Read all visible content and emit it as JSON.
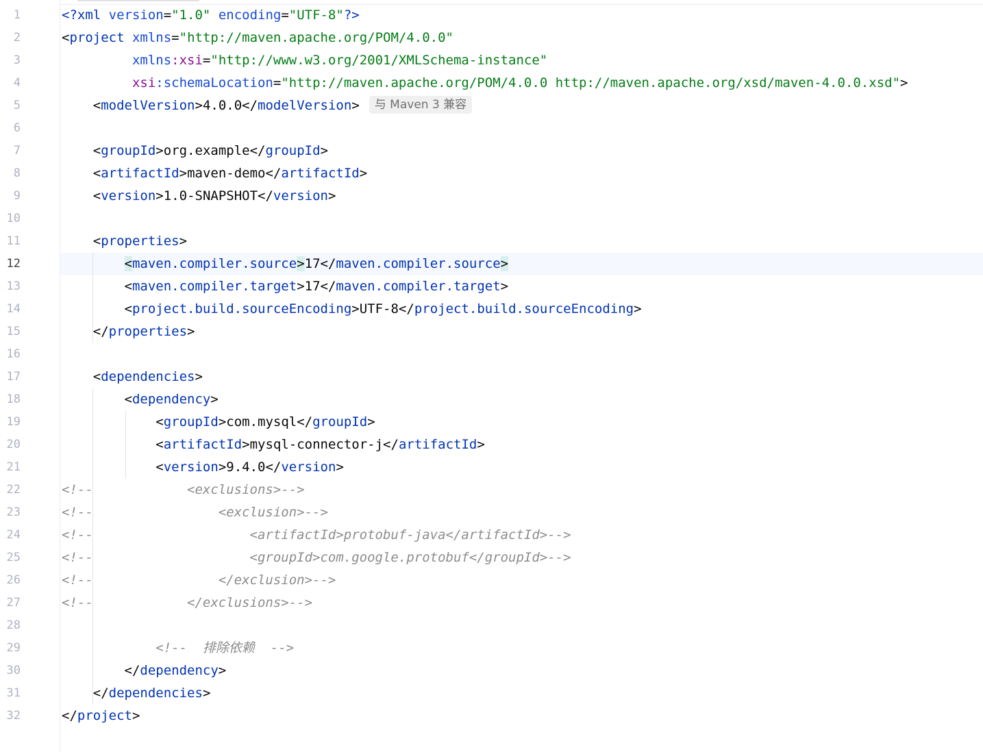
{
  "editor": {
    "current_line": 12,
    "inlay_hint": "与 Maven 3 兼容",
    "lines": [
      {
        "n": "1",
        "indent": 0,
        "tokens": [
          [
            "decl",
            "<?xml "
          ],
          [
            "attr",
            "version"
          ],
          [
            "bracket",
            "="
          ],
          [
            "str",
            "\"1.0\""
          ],
          [
            "attr",
            " encoding"
          ],
          [
            "bracket",
            "="
          ],
          [
            "str",
            "\"UTF-8\""
          ],
          [
            "decl",
            "?>"
          ]
        ]
      },
      {
        "n": "2",
        "indent": 0,
        "tokens": [
          [
            "bracket",
            "<"
          ],
          [
            "tag",
            "project "
          ],
          [
            "attr",
            "xmlns"
          ],
          [
            "bracket",
            "="
          ],
          [
            "str",
            "\"http://maven.apache.org/POM/4.0.0\""
          ]
        ]
      },
      {
        "n": "3",
        "indent": 9,
        "tokens": [
          [
            "attr",
            "xmlns"
          ],
          [
            "ns",
            ":xsi"
          ],
          [
            "bracket",
            "="
          ],
          [
            "str",
            "\"http://www.w3.org/2001/XMLSchema-instance\""
          ]
        ]
      },
      {
        "n": "4",
        "indent": 9,
        "tokens": [
          [
            "ns",
            "xsi"
          ],
          [
            "attr",
            ":schemaLocation"
          ],
          [
            "bracket",
            "="
          ],
          [
            "str",
            "\"http://maven.apache.org/POM/4.0.0 http://maven.apache.org/xsd/maven-4.0.0.xsd\""
          ],
          [
            "bracket",
            ">"
          ]
        ]
      },
      {
        "n": "5",
        "indent": 4,
        "inlay": true,
        "tokens": [
          [
            "bracket",
            "<"
          ],
          [
            "tag",
            "modelVersion"
          ],
          [
            "bracket",
            ">"
          ],
          [
            "text",
            "4.0.0"
          ],
          [
            "bracket",
            "</"
          ],
          [
            "tag",
            "modelVersion"
          ],
          [
            "bracket",
            ">"
          ]
        ]
      },
      {
        "n": "6",
        "indent": 0,
        "tokens": []
      },
      {
        "n": "7",
        "indent": 4,
        "tokens": [
          [
            "bracket",
            "<"
          ],
          [
            "tag",
            "groupId"
          ],
          [
            "bracket",
            ">"
          ],
          [
            "text",
            "org.example"
          ],
          [
            "bracket",
            "</"
          ],
          [
            "tag",
            "groupId"
          ],
          [
            "bracket",
            ">"
          ]
        ]
      },
      {
        "n": "8",
        "indent": 4,
        "tokens": [
          [
            "bracket",
            "<"
          ],
          [
            "tag",
            "artifactId"
          ],
          [
            "bracket",
            ">"
          ],
          [
            "text",
            "maven-demo"
          ],
          [
            "bracket",
            "</"
          ],
          [
            "tag",
            "artifactId"
          ],
          [
            "bracket",
            ">"
          ]
        ]
      },
      {
        "n": "9",
        "indent": 4,
        "tokens": [
          [
            "bracket",
            "<"
          ],
          [
            "tag",
            "version"
          ],
          [
            "bracket",
            ">"
          ],
          [
            "text",
            "1.0-SNAPSHOT"
          ],
          [
            "bracket",
            "</"
          ],
          [
            "tag",
            "version"
          ],
          [
            "bracket",
            ">"
          ]
        ]
      },
      {
        "n": "10",
        "indent": 0,
        "tokens": []
      },
      {
        "n": "11",
        "indent": 4,
        "tokens": [
          [
            "bracket",
            "<"
          ],
          [
            "tag",
            "properties"
          ],
          [
            "bracket",
            ">"
          ]
        ]
      },
      {
        "n": "12",
        "indent": 8,
        "tokens": [
          [
            "match",
            "<"
          ],
          [
            "tag",
            "maven.compiler.source"
          ],
          [
            "match",
            ">"
          ],
          [
            "text",
            "17"
          ],
          [
            "bracket",
            "</"
          ],
          [
            "tag",
            "maven.compiler.source"
          ],
          [
            "match",
            ">"
          ]
        ]
      },
      {
        "n": "13",
        "indent": 8,
        "tokens": [
          [
            "bracket",
            "<"
          ],
          [
            "tag",
            "maven.compiler.target"
          ],
          [
            "bracket",
            ">"
          ],
          [
            "text",
            "17"
          ],
          [
            "bracket",
            "</"
          ],
          [
            "tag",
            "maven.compiler.target"
          ],
          [
            "bracket",
            ">"
          ]
        ]
      },
      {
        "n": "14",
        "indent": 8,
        "tokens": [
          [
            "bracket",
            "<"
          ],
          [
            "tag",
            "project.build.sourceEncoding"
          ],
          [
            "bracket",
            ">"
          ],
          [
            "text",
            "UTF-8"
          ],
          [
            "bracket",
            "</"
          ],
          [
            "tag",
            "project.build.sourceEncoding"
          ],
          [
            "bracket",
            ">"
          ]
        ]
      },
      {
        "n": "15",
        "indent": 4,
        "tokens": [
          [
            "bracket",
            "</"
          ],
          [
            "tag",
            "properties"
          ],
          [
            "bracket",
            ">"
          ]
        ]
      },
      {
        "n": "16",
        "indent": 0,
        "tokens": []
      },
      {
        "n": "17",
        "indent": 4,
        "tokens": [
          [
            "bracket",
            "<"
          ],
          [
            "tag",
            "dependencies"
          ],
          [
            "bracket",
            ">"
          ]
        ]
      },
      {
        "n": "18",
        "indent": 8,
        "tokens": [
          [
            "bracket",
            "<"
          ],
          [
            "tag",
            "dependency"
          ],
          [
            "bracket",
            ">"
          ]
        ]
      },
      {
        "n": "19",
        "indent": 12,
        "tokens": [
          [
            "bracket",
            "<"
          ],
          [
            "tag",
            "groupId"
          ],
          [
            "bracket",
            ">"
          ],
          [
            "text",
            "com.mysql"
          ],
          [
            "bracket",
            "</"
          ],
          [
            "tag",
            "groupId"
          ],
          [
            "bracket",
            ">"
          ]
        ]
      },
      {
        "n": "20",
        "indent": 12,
        "tokens": [
          [
            "bracket",
            "<"
          ],
          [
            "tag",
            "artifactId"
          ],
          [
            "bracket",
            ">"
          ],
          [
            "text",
            "mysql-connector-j"
          ],
          [
            "bracket",
            "</"
          ],
          [
            "tag",
            "artifactId"
          ],
          [
            "bracket",
            ">"
          ]
        ]
      },
      {
        "n": "21",
        "indent": 12,
        "tokens": [
          [
            "bracket",
            "<"
          ],
          [
            "tag",
            "version"
          ],
          [
            "bracket",
            ">"
          ],
          [
            "text",
            "9.4.0"
          ],
          [
            "bracket",
            "</"
          ],
          [
            "tag",
            "version"
          ],
          [
            "bracket",
            ">"
          ]
        ]
      },
      {
        "n": "22",
        "indent": 0,
        "tokens": [
          [
            "comment",
            "<!--            <exclusions>-->"
          ]
        ]
      },
      {
        "n": "23",
        "indent": 0,
        "tokens": [
          [
            "comment",
            "<!--                <exclusion>-->"
          ]
        ]
      },
      {
        "n": "24",
        "indent": 0,
        "tokens": [
          [
            "comment",
            "<!--                    <artifactId>protobuf-java</artifactId>-->"
          ]
        ]
      },
      {
        "n": "25",
        "indent": 0,
        "tokens": [
          [
            "comment",
            "<!--                    <groupId>com.google.protobuf</groupId>-->"
          ]
        ]
      },
      {
        "n": "26",
        "indent": 0,
        "tokens": [
          [
            "comment",
            "<!--                </exclusion>-->"
          ]
        ]
      },
      {
        "n": "27",
        "indent": 0,
        "tokens": [
          [
            "comment",
            "<!--            </exclusions>-->"
          ]
        ]
      },
      {
        "n": "28",
        "indent": 0,
        "tokens": []
      },
      {
        "n": "29",
        "indent": 12,
        "tokens": [
          [
            "comment",
            "<!--  排除依赖  -->"
          ]
        ]
      },
      {
        "n": "30",
        "indent": 8,
        "tokens": [
          [
            "bracket",
            "</"
          ],
          [
            "tag",
            "dependency"
          ],
          [
            "bracket",
            ">"
          ]
        ]
      },
      {
        "n": "31",
        "indent": 4,
        "tokens": [
          [
            "bracket",
            "</"
          ],
          [
            "tag",
            "dependencies"
          ],
          [
            "bracket",
            ">"
          ]
        ]
      },
      {
        "n": "32",
        "indent": 0,
        "tokens": [
          [
            "bracket",
            "</"
          ],
          [
            "tag",
            "project"
          ],
          [
            "bracket",
            ">"
          ]
        ]
      }
    ]
  }
}
